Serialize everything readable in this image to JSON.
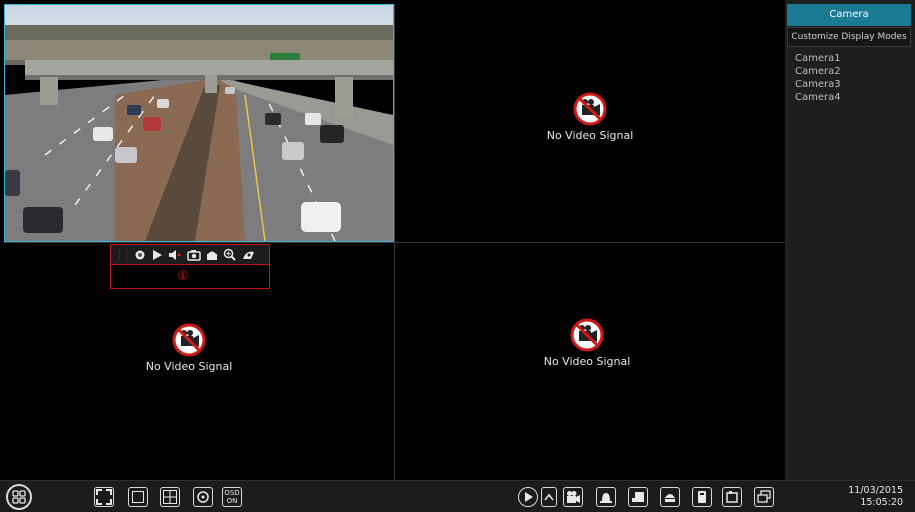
{
  "cameras": {
    "no_signal_text": "No Video Signal"
  },
  "toolbar": {
    "marker": "①"
  },
  "panel": {
    "tab_camera": "Camera",
    "tab_customize": "Customize Display Modes",
    "camera_list": [
      "Camera1",
      "Camera2",
      "Camera3",
      "Camera4"
    ]
  },
  "bottom": {
    "osd_line1": "OSD",
    "osd_line2": "ON",
    "date": "11/03/2015",
    "time": "15:05:20"
  },
  "colors": {
    "accent": "#1a7a94",
    "selection_border": "#39b5d6",
    "highlight_red": "#c01818"
  }
}
